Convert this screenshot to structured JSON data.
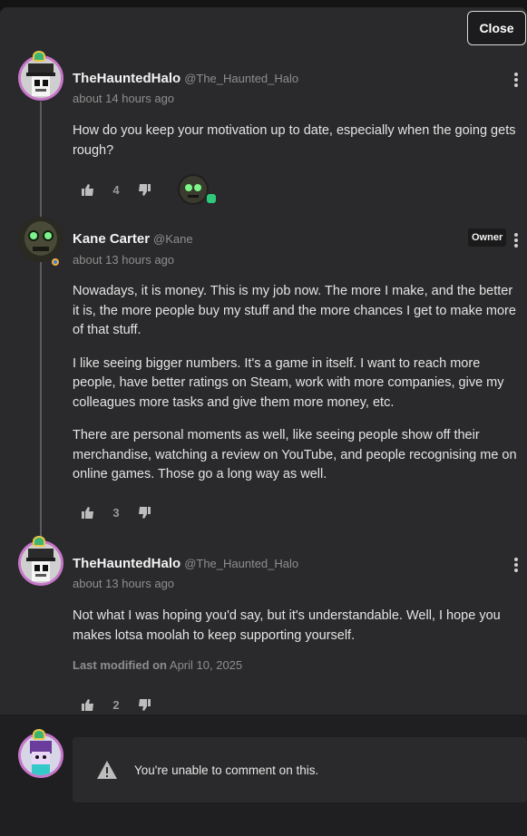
{
  "header": {
    "close_label": "Close"
  },
  "comments": [
    {
      "author": "TheHauntedHalo",
      "handle": "@The_Haunted_Halo",
      "time": "about 14 hours ago",
      "paragraphs": [
        "How do you keep your motivation up to date, especially when the going gets rough?"
      ],
      "likes": "4"
    },
    {
      "author": "Kane Carter",
      "handle": "@Kane",
      "badge": "Owner",
      "time": "about 13 hours ago",
      "paragraphs": [
        "Nowadays, it is money. This is my job now. The more I make, and the better it is, the more people buy my stuff and the more chances I get to make more of that stuff.",
        "I like seeing bigger numbers. It's a game in itself. I want to reach more people, have better ratings on Steam, work with more companies, give my colleagues more tasks and give them more money, etc.",
        "There are personal moments as well, like seeing people show off their merchandise, watching a review on YouTube, and people recognising me on online games. Those go a long way as well."
      ],
      "likes": "3"
    },
    {
      "author": "TheHauntedHalo",
      "handle": "@The_Haunted_Halo",
      "time": "about 13 hours ago",
      "paragraphs": [
        "Not what I was hoping you'd say, but it's understandable. Well, I hope you makes lotsa moolah to keep supporting yourself."
      ],
      "modified_label": "Last modified on",
      "modified_date": "April 10, 2025",
      "likes": "2"
    }
  ],
  "compose": {
    "notice": "You're unable to comment on this."
  },
  "colors": {
    "panel": "#2a2a2c",
    "halo_ring": "#c776c9",
    "accent_green": "#2ec97a"
  }
}
